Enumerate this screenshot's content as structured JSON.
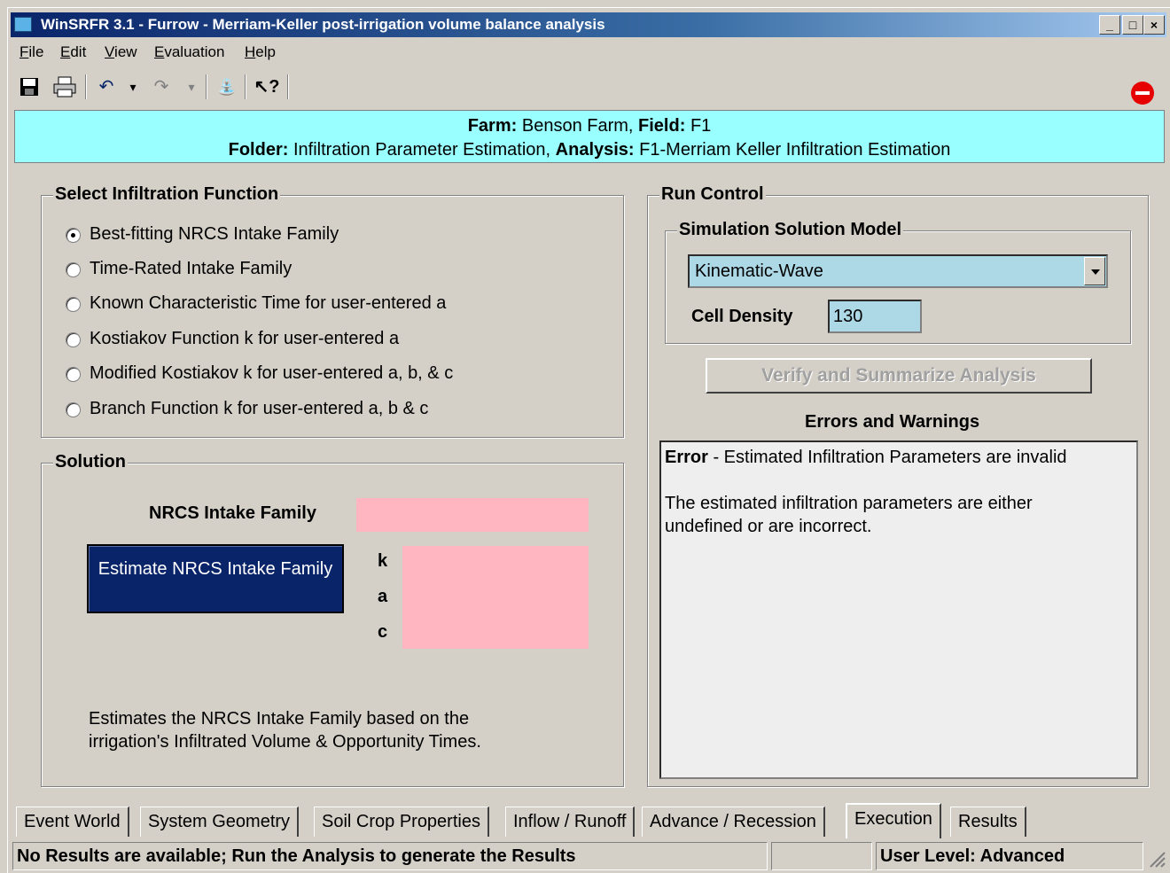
{
  "window": {
    "title": "WinSRFR 3.1 - Furrow - Merriam-Keller post-irrigation volume balance analysis",
    "controls": [
      "_",
      "□",
      "×"
    ]
  },
  "menu": [
    "File",
    "Edit",
    "View",
    "Evaluation",
    "Help"
  ],
  "toolbar": {
    "icons": [
      "save-icon",
      "print-icon",
      "undo-icon",
      "undo-dropdown-icon",
      "redo-icon",
      "redo-dropdown-icon",
      "water-icon",
      "help-pointer-icon",
      "stop-icon"
    ],
    "glyphs": {
      "undo": "↶",
      "undo_drop": "▾",
      "redo": "↷",
      "redo_drop": "▾",
      "water": "⛲",
      "help": "↖?"
    }
  },
  "header": {
    "farm_label": "Farm:",
    "farm": "Benson Farm,",
    "field_label": "Field:",
    "field": "F1",
    "folder_label": "Folder:",
    "folder": "Infiltration Parameter Estimation,",
    "analysis_label": "Analysis:",
    "analysis": "F1-Merriam Keller Infiltration Estimation",
    "background": "#99ffff"
  },
  "infiltration": {
    "legend": "Select Infiltration Function",
    "options": [
      {
        "label": "Best-fitting NRCS Intake Family",
        "selected": true
      },
      {
        "label": "Time-Rated Intake Family",
        "selected": false
      },
      {
        "label": "Known Characteristic Time for user-entered a",
        "selected": false
      },
      {
        "label": "Kostiakov Function k for user-entered a",
        "selected": false
      },
      {
        "label": "Modified Kostiakov k for user-entered a, b, & c",
        "selected": false
      },
      {
        "label": "Branch Function k for user-entered a, b & c",
        "selected": false
      }
    ]
  },
  "solution": {
    "legend": "Solution",
    "family_label": "NRCS Intake Family",
    "estimate_button": "Estimate NRCS Intake Family",
    "k_label": "k",
    "a_label": "a",
    "c_label": "c",
    "description_line1": "Estimates the NRCS Intake Family based on the",
    "description_line2": "irrigation's Infiltrated Volume & Opportunity Times.",
    "field_color": "#ffb6c1",
    "button_color": "#0a246a"
  },
  "run_control": {
    "legend": "Run Control",
    "model_legend": "Simulation Solution Model",
    "model_value": "Kinematic-Wave",
    "cell_density_label": "Cell Density",
    "cell_density_value": "130",
    "verify_button": "Verify and Summarize Analysis",
    "errors_title": "Errors and Warnings",
    "error_label": "Error",
    "error_summary": " - Estimated Infiltration Parameters are invalid",
    "error_detail_line1": "The estimated infiltration parameters are either",
    "error_detail_line2": "undefined or are incorrect.",
    "input_color": "#add8e6"
  },
  "tabs": [
    "Event World",
    "System Geometry",
    "Soil Crop Properties",
    "Inflow / Runoff",
    "Advance / Recession",
    "Execution",
    "Results"
  ],
  "active_tab": "Execution",
  "status": {
    "message": "No Results are available; Run the Analysis to generate the Results",
    "blank": "",
    "user_level": "User Level:  Advanced"
  }
}
